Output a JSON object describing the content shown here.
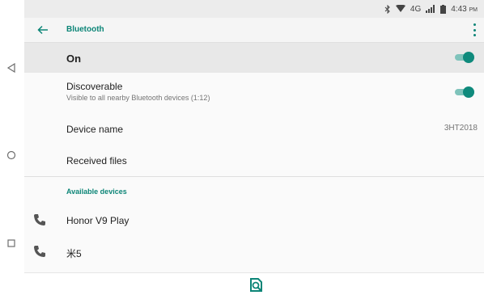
{
  "colors": {
    "accent": "#0c8577",
    "toggle_on": "#0f8a7c",
    "on_row_bg": "#e8e8e8"
  },
  "navbar": {
    "back_icon": "nav-back-triangle-icon",
    "home_icon": "nav-home-circle-icon",
    "recents_icon": "nav-recents-square-icon"
  },
  "status_bar": {
    "icons": [
      "bluetooth-icon",
      "wifi-icon",
      "signal-icon",
      "battery-icon"
    ],
    "network": "4G",
    "time": "4:43",
    "ampm": "PM"
  },
  "app_bar": {
    "title": "Bluetooth",
    "back_icon": "back-arrow-icon",
    "menu_icon": "more-vert-icon"
  },
  "bluetooth_toggle": {
    "label": "On",
    "enabled": true
  },
  "discoverable": {
    "title": "Discoverable",
    "subtitle": "Visible to all nearby Bluetooth devices (1:12)",
    "enabled": true
  },
  "device_name": {
    "label": "Device name",
    "value": "3HT2018"
  },
  "received_files": {
    "label": "Received files"
  },
  "available_devices": {
    "header": "Available devices",
    "items": [
      {
        "name": "Honor V9 Play",
        "icon": "phone-icon"
      },
      {
        "name": "米5",
        "icon": "phone-icon"
      }
    ]
  },
  "bottom_action": {
    "icon": "scan-search-icon"
  }
}
